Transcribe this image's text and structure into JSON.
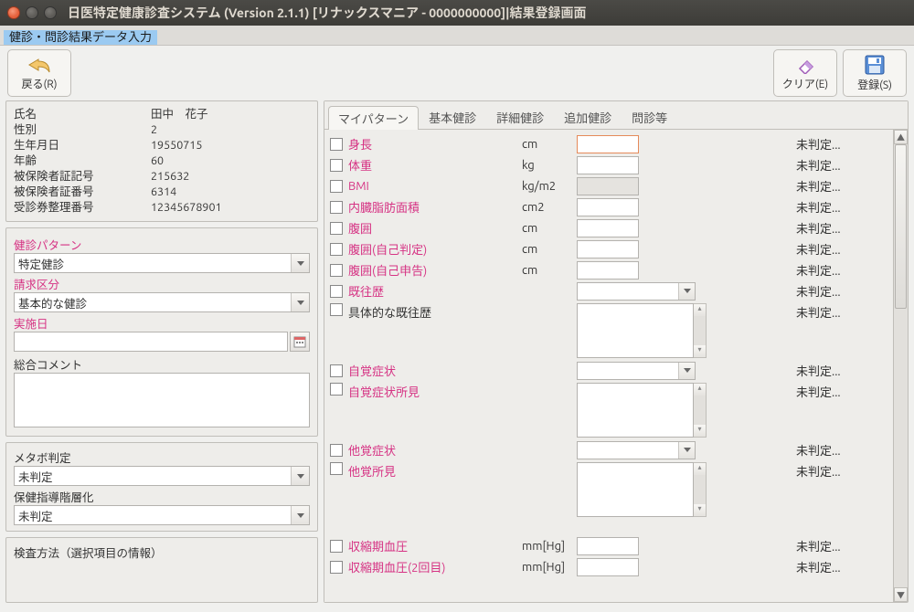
{
  "window": {
    "title": "日医特定健康診査システム (Version 2.1.1) [リナックスマニア - 0000000000]|結果登録画面"
  },
  "header_tab": "健診・問診結果データ入力",
  "toolbar": {
    "back": "戻る(R)",
    "clear": "クリア(E)",
    "save": "登録(S)"
  },
  "patient": {
    "labels": {
      "name": "氏名",
      "sex": "性別",
      "dob": "生年月日",
      "age": "年齢",
      "ins_symbol": "被保険者証記号",
      "ins_number": "被保険者証番号",
      "ticket": "受診券整理番号"
    },
    "values": {
      "name": "田中　花子",
      "sex": "2",
      "dob": "19550715",
      "age": "60",
      "ins_symbol": "215632",
      "ins_number": "6314",
      "ticket": "12345678901"
    }
  },
  "left": {
    "pattern_label": "健診パターン",
    "pattern_value": "特定健診",
    "billing_label": "請求区分",
    "billing_value": "基本的な健診",
    "date_label": "実施日",
    "comment_label": "総合コメント",
    "metabo_label": "メタボ判定",
    "metabo_value": "未判定",
    "guidance_label": "保健指導階層化",
    "guidance_value": "未判定",
    "method_label": "検査方法（選択項目の情報）"
  },
  "tabs": [
    "マイパターン",
    "基本健診",
    "詳細健診",
    "追加健診",
    "問診等"
  ],
  "status_default": "未判定...",
  "items": [
    {
      "label": "身長",
      "pink": true,
      "unit": "cm",
      "type": "input",
      "focus": true
    },
    {
      "label": "体重",
      "pink": true,
      "unit": "kg",
      "type": "input"
    },
    {
      "label": "BMI",
      "pink": true,
      "unit": "kg/m2",
      "type": "input",
      "disabled": true
    },
    {
      "label": "内臓脂肪面積",
      "pink": true,
      "unit": "cm2",
      "type": "input"
    },
    {
      "label": "腹囲",
      "pink": true,
      "unit": "cm",
      "type": "input"
    },
    {
      "label": "腹囲(自己判定)",
      "pink": true,
      "unit": "cm",
      "type": "input"
    },
    {
      "label": "腹囲(自己申告)",
      "pink": true,
      "unit": "cm",
      "type": "input"
    },
    {
      "label": "既往歴",
      "pink": true,
      "unit": "",
      "type": "select"
    },
    {
      "label": "具体的な既往歴",
      "pink": false,
      "unit": "",
      "type": "textarea"
    },
    {
      "label": "自覚症状",
      "pink": true,
      "unit": "",
      "type": "select"
    },
    {
      "label": "自覚症状所見",
      "pink": true,
      "unit": "",
      "type": "textarea"
    },
    {
      "label": "他覚症状",
      "pink": true,
      "unit": "",
      "type": "select"
    },
    {
      "label": "他覚所見",
      "pink": true,
      "unit": "",
      "type": "textarea"
    },
    {
      "label": "",
      "pink": false,
      "unit": "",
      "type": "spacer"
    },
    {
      "label": "収縮期血圧",
      "pink": true,
      "unit": "mm[Hg]",
      "type": "input"
    },
    {
      "label": "収縮期血圧(2回目)",
      "pink": true,
      "unit": "mm[Hg]",
      "type": "input"
    }
  ]
}
